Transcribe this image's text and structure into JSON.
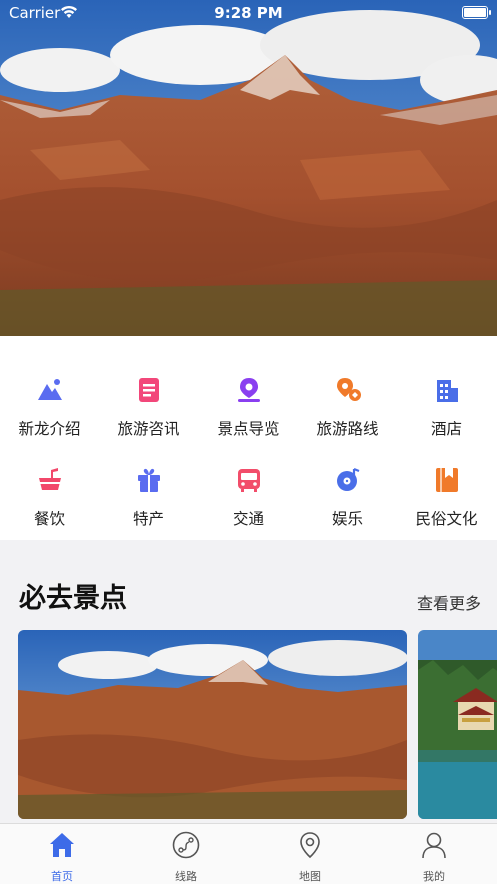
{
  "status_bar": {
    "carrier": "Carrier",
    "time": "9:28 PM"
  },
  "menu": [
    {
      "label": "新龙介绍",
      "icon": "mountain-icon",
      "color": "#5a6cf0"
    },
    {
      "label": "旅游咨讯",
      "icon": "document-icon",
      "color": "#f2477a"
    },
    {
      "label": "景点导览",
      "icon": "map-pin-icon",
      "color": "#8a3ff0"
    },
    {
      "label": "旅游路线",
      "icon": "route-icon",
      "color": "#f07a2a"
    },
    {
      "label": "酒店",
      "icon": "building-icon",
      "color": "#4a6ee8"
    },
    {
      "label": "餐饮",
      "icon": "food-icon",
      "color": "#f2476a"
    },
    {
      "label": "特产",
      "icon": "gift-icon",
      "color": "#5a6cf0"
    },
    {
      "label": "交通",
      "icon": "bus-icon",
      "color": "#f24d6a"
    },
    {
      "label": "娱乐",
      "icon": "music-icon",
      "color": "#4a6ee8"
    },
    {
      "label": "民俗文化",
      "icon": "book-icon",
      "color": "#f07a2a"
    }
  ],
  "section": {
    "title": "必去景点",
    "more": "查看更多"
  },
  "tabs": [
    {
      "label": "首页",
      "icon": "home-icon"
    },
    {
      "label": "线路",
      "icon": "route-circle-icon"
    },
    {
      "label": "地图",
      "icon": "map-pin-outline-icon"
    },
    {
      "label": "我的",
      "icon": "user-icon"
    }
  ],
  "colors": {
    "accent": "#3d6be8"
  }
}
